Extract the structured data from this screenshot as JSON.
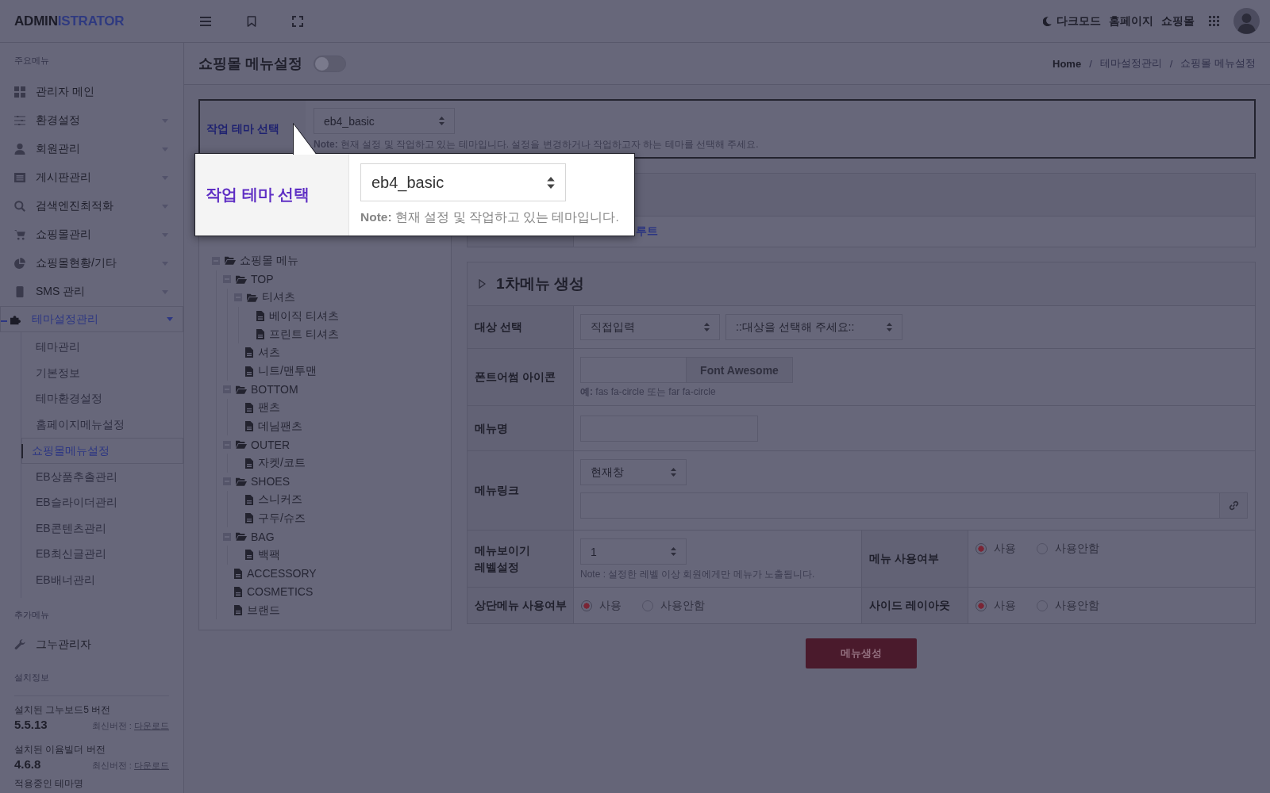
{
  "topbar": {
    "logo": {
      "dark": "ADMIN",
      "accent": "ISTRATOR"
    },
    "links": [
      {
        "kind": "dark-mode",
        "label": "다크모드"
      },
      {
        "kind": "plain",
        "label": "홈페이지"
      },
      {
        "kind": "plain",
        "label": "쇼핑몰"
      }
    ]
  },
  "sidebar": {
    "main_heading": "주요메뉴",
    "items": [
      {
        "label": "관리자 메인",
        "selected": false
      },
      {
        "label": "환경설정",
        "selected": false,
        "expanded": false
      },
      {
        "label": "회원관리",
        "selected": false,
        "expanded": false
      },
      {
        "label": "게시판관리",
        "selected": false,
        "expanded": false
      },
      {
        "label": "검색엔진최적화",
        "selected": false,
        "expanded": false
      },
      {
        "label": "쇼핑몰관리",
        "selected": false,
        "expanded": false
      },
      {
        "label": "쇼핑몰현황/기타",
        "selected": false,
        "expanded": false
      },
      {
        "label": "SMS 관리",
        "selected": false,
        "expanded": false
      },
      {
        "label": "테마설정관리",
        "selected": true,
        "expanded": true,
        "children": [
          {
            "label": "테마관리",
            "selected": false
          },
          {
            "label": "기본정보",
            "selected": false
          },
          {
            "label": "테마환경설정",
            "selected": false
          },
          {
            "label": "홈페이지메뉴설정",
            "selected": false
          },
          {
            "label": "쇼핑몰메뉴설정",
            "selected": true
          },
          {
            "label": "EB상품추출관리",
            "selected": false
          },
          {
            "label": "EB슬라이더관리",
            "selected": false
          },
          {
            "label": "EB콘텐츠관리",
            "selected": false
          },
          {
            "label": "EB최신글관리",
            "selected": false
          },
          {
            "label": "EB배너관리",
            "selected": false
          }
        ]
      }
    ],
    "extra_heading": "추가메뉴",
    "extra_items": [
      {
        "label": "그누관리자",
        "selected": false
      }
    ],
    "install_heading": "설치정보",
    "versions": [
      {
        "label": "설치된 그누보드5 버전",
        "version": "5.5.13",
        "latest": "최신버전 :",
        "link": "다운로드"
      },
      {
        "label": "설치된 이윰빌더 버전",
        "version": "4.6.8",
        "latest": "최신버전 :",
        "link": "다운로드"
      }
    ],
    "theme_heading": "적용중인 테마명"
  },
  "page_header": {
    "title": "쇼핑몰 메뉴설정",
    "toggle": {
      "on": false
    },
    "breadcrumb": [
      {
        "kind": "link",
        "label": "Home"
      },
      {
        "kind": "separator",
        "label": "/"
      },
      {
        "kind": "text",
        "label": "테마설정관리"
      },
      {
        "kind": "separator",
        "label": "/"
      },
      {
        "kind": "text",
        "label": "쇼핑몰 메뉴설정"
      }
    ]
  },
  "theme_row": {
    "label": "작업 테마 선택",
    "value": "eb4_basic",
    "note": "**Note:** 현재 설정 및 작업하고 있는 테마입니다. 설정을 변경하거나 작업하고자 하는 테마를 선택해 주세요."
  },
  "tour_tooltip": {
    "label": "작업 테마 선택",
    "value": "eb4_basic",
    "note": "**Note:** 현재 설정 및 작업하고 있는 테마입니다."
  },
  "structure_panel": {
    "value": "루트"
  },
  "tree_panel": {
    "nodes": [
      {
        "label": "쇼핑몰 메뉴",
        "kind": "folder",
        "expanded": true,
        "children": [
          {
            "label": "TOP",
            "kind": "folder",
            "expanded": true,
            "children": [
              {
                "label": "티셔츠",
                "kind": "folder",
                "expanded": true,
                "children": [
                  {
                    "label": "베이직 티셔츠",
                    "kind": "page"
                  },
                  {
                    "label": "프린트 티셔츠",
                    "kind": "page"
                  }
                ]
              },
              {
                "label": "셔츠",
                "kind": "page"
              },
              {
                "label": "니트/맨투맨",
                "kind": "page"
              }
            ]
          },
          {
            "label": "BOTTOM",
            "kind": "folder",
            "expanded": true,
            "children": [
              {
                "label": "팬츠",
                "kind": "page"
              },
              {
                "label": "데님팬츠",
                "kind": "page"
              }
            ]
          },
          {
            "label": "OUTER",
            "kind": "folder",
            "expanded": true,
            "children": [
              {
                "label": "자켓/코트",
                "kind": "page"
              }
            ]
          },
          {
            "label": "SHOES",
            "kind": "folder",
            "expanded": true,
            "children": [
              {
                "label": "스니커즈",
                "kind": "page"
              },
              {
                "label": "구두/슈즈",
                "kind": "page"
              }
            ]
          },
          {
            "label": "BAG",
            "kind": "folder",
            "expanded": true,
            "children": [
              {
                "label": "백팩",
                "kind": "page"
              }
            ]
          },
          {
            "label": "ACCESSORY",
            "kind": "page"
          },
          {
            "label": "COSMETICS",
            "kind": "page"
          },
          {
            "label": "브랜드",
            "kind": "page"
          }
        ]
      }
    ]
  },
  "create_panel": {
    "title": "1차메뉴 생성",
    "rows": [
      {
        "kind": "selects",
        "label": "대상 선택",
        "selects": [
          "직접입력",
          "::대상을 선택해 주세요::"
        ]
      },
      {
        "kind": "icon-input",
        "label": "폰트어썸 아이콘",
        "button": "Font Awesome",
        "hint": "**예:** fas fa-circle 또는 far fa-circle"
      },
      {
        "kind": "text-input",
        "label": "메뉴명"
      },
      {
        "kind": "link",
        "label": "메뉴링크",
        "select": "현재창"
      },
      {
        "kind": "pair",
        "cells": [
          {
            "kind": "level-select",
            "label": "메뉴보이기\n레벨설정",
            "value": "1",
            "note": "Note : 설정한 레벨 이상 회원에게만 메뉴가 노출됩니다."
          },
          {
            "kind": "radios",
            "label": "메뉴 사용여부",
            "options": [
              {
                "label": "사용",
                "selected": true
              },
              {
                "label": "사용안함",
                "selected": false
              }
            ]
          }
        ]
      },
      {
        "kind": "pair",
        "cells": [
          {
            "kind": "radios",
            "label": "상단메뉴 사용여부",
            "options": [
              {
                "label": "사용",
                "selected": true
              },
              {
                "label": "사용안함",
                "selected": false
              }
            ]
          },
          {
            "kind": "radios",
            "label": "사이드 레이아웃",
            "options": [
              {
                "label": "사용",
                "selected": true
              },
              {
                "label": "사용안함",
                "selected": false
              }
            ]
          }
        ]
      }
    ],
    "submit": "메뉴생성"
  }
}
